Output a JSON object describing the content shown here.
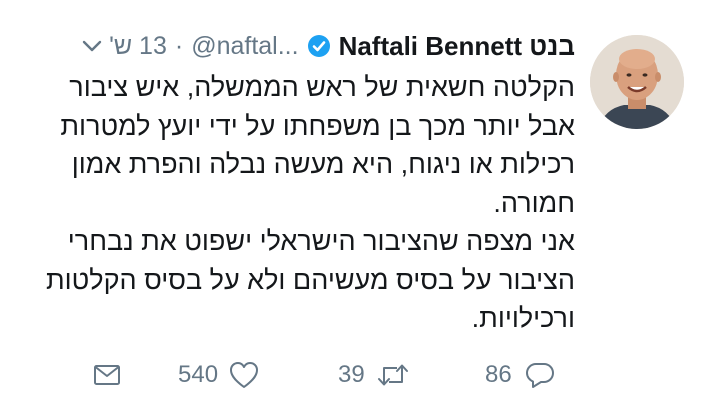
{
  "tweet": {
    "display_name": "בנט Naftali Bennett",
    "handle": "@naftal...",
    "time": "13 ש'",
    "verified_icon": "verified-badge-icon",
    "menu_icon": "chevron-down-icon",
    "avatar_icon": "avatar-photo",
    "body_paragraphs": [
      "הקלטה חשאית של ראש הממשלה, איש ציבור אבל יותר מכך בן משפחתו על ידי יועץ למטרות רכילות או ניגוח, היא מעשה נבלה והפרת אמון חמורה.",
      "אני מצפה שהציבור הישראלי ישפוט את נבחרי הציבור על בסיס מעשיהם ולא על בסיס הקלטות ורכילויות."
    ]
  },
  "actions": {
    "reply": {
      "icon": "reply-icon",
      "count": "86"
    },
    "retweet": {
      "icon": "retweet-icon",
      "count": "39"
    },
    "like": {
      "icon": "heart-icon",
      "count": "540"
    },
    "dm": {
      "icon": "mail-icon"
    }
  },
  "colors": {
    "text": "#14171a",
    "muted": "#657786",
    "verified": "#1da1f2"
  }
}
